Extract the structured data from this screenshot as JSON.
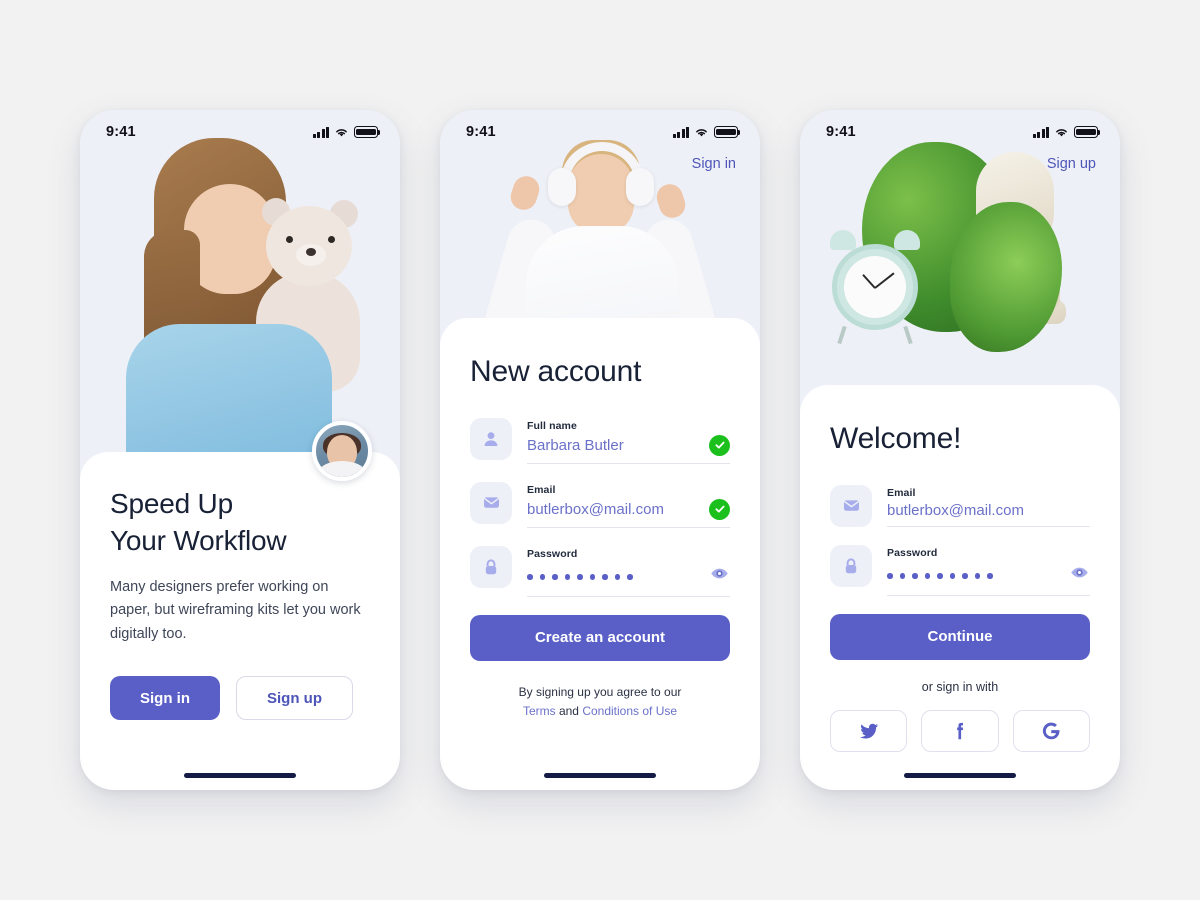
{
  "statusbar": {
    "time": "9:41"
  },
  "screens": [
    {
      "id": "onboarding",
      "headline_line1": "Speed Up",
      "headline_line2": "Your Workflow",
      "body": "Many designers prefer working on paper, but wireframing kits let you work digitally too.",
      "primary_button": "Sign in",
      "secondary_button": "Sign up"
    },
    {
      "id": "new-account",
      "corner_link": "Sign in",
      "title": "New account",
      "fields": [
        {
          "label": "Full name",
          "value": "Barbara Butler",
          "icon": "person-icon",
          "valid": true
        },
        {
          "label": "Email",
          "value": "butlerbox@mail.com",
          "icon": "envelope-icon",
          "valid": true
        },
        {
          "label": "Password",
          "value": "•••••••••",
          "icon": "lock-icon",
          "masked": true,
          "dots": 9
        }
      ],
      "submit_button": "Create an account",
      "legal_prefix": "By signing up you agree to our",
      "legal_terms": "Terms",
      "legal_and": "and",
      "legal_conditions": "Conditions of Use"
    },
    {
      "id": "welcome",
      "corner_link": "Sign up",
      "title": "Welcome!",
      "fields": [
        {
          "label": "Email",
          "value": "butlerbox@mail.com",
          "icon": "envelope-icon"
        },
        {
          "label": "Password",
          "value": "•••••••••",
          "icon": "lock-icon",
          "masked": true,
          "dots": 9
        }
      ],
      "submit_button": "Continue",
      "or_text": "or sign in with",
      "social": [
        {
          "name": "twitter",
          "glyph": "twitter-icon"
        },
        {
          "name": "facebook",
          "glyph": "facebook-icon"
        },
        {
          "name": "google",
          "glyph": "google-icon"
        }
      ]
    }
  ],
  "colors": {
    "accent": "#5a5fc7",
    "accent_text": "#4d55b8",
    "value_text": "#6b71c9",
    "success": "#1cc01c",
    "hero_bg": "#eef0f7",
    "page_bg": "#f2f2f2",
    "heading": "#182135",
    "home_indicator": "#141b44"
  }
}
